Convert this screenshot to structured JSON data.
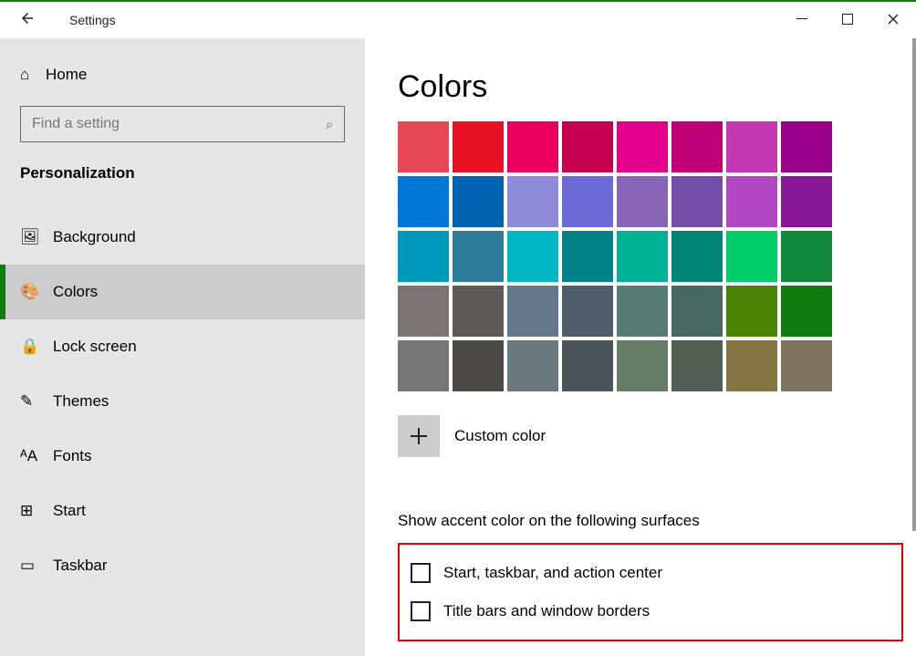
{
  "window": {
    "title": "Settings"
  },
  "sidebar": {
    "home": "Home",
    "search_placeholder": "Find a setting",
    "section": "Personalization",
    "items": [
      {
        "icon": "🖼",
        "label": "Background"
      },
      {
        "icon": "🎨",
        "label": "Colors"
      },
      {
        "icon": "🔒",
        "label": "Lock screen"
      },
      {
        "icon": "✎",
        "label": "Themes"
      },
      {
        "icon": "ᴬA",
        "label": "Fonts"
      },
      {
        "icon": "⊞",
        "label": "Start"
      },
      {
        "icon": "▭",
        "label": "Taskbar"
      }
    ],
    "selected_index": 1
  },
  "main": {
    "heading": "Colors",
    "swatches": [
      "#e74856",
      "#e81123",
      "#ea005e",
      "#c30052",
      "#e3008c",
      "#bf0077",
      "#c239b3",
      "#9a0089",
      "#0078d7",
      "#0063b1",
      "#8e8cd8",
      "#6b69d6",
      "#8764b8",
      "#744da9",
      "#b146c2",
      "#881798",
      "#0099bc",
      "#2d7d9a",
      "#00b7c3",
      "#038387",
      "#00b294",
      "#018574",
      "#00cc6a",
      "#10893e",
      "#7a7574",
      "#5d5a58",
      "#68768a",
      "#515c6b",
      "#567c73",
      "#486860",
      "#498205",
      "#107c10",
      "#767676",
      "#4c4a48",
      "#69797e",
      "#4a5459",
      "#647c64",
      "#525e54",
      "#847545",
      "#7e735f"
    ],
    "custom_label": "Custom color",
    "section_label": "Show accent color on the following surfaces",
    "checks": [
      "Start, taskbar, and action center",
      "Title bars and window borders"
    ]
  }
}
